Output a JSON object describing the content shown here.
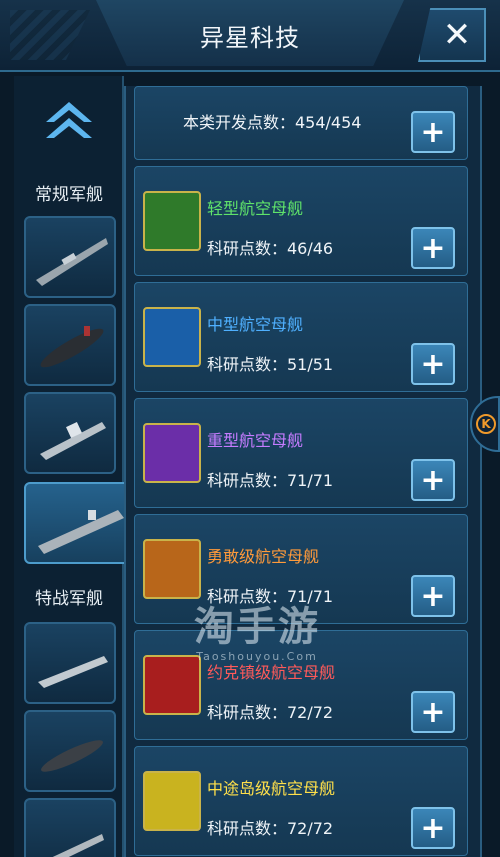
{
  "header": {
    "title": "异星科技"
  },
  "sidebar": {
    "categories": [
      {
        "label": "常规军舰"
      },
      {
        "label": "特战军舰"
      }
    ]
  },
  "list": {
    "summary": {
      "text": "本类开发点数：454/454"
    },
    "items": [
      {
        "name": "轻型航空母舰",
        "points": "科研点数：46/46",
        "name_color": "#5fe36a",
        "icon_color": "#2f7a2a"
      },
      {
        "name": "中型航空母舰",
        "points": "科研点数：51/51",
        "name_color": "#4fb0ff",
        "icon_color": "#1a5fa8"
      },
      {
        "name": "重型航空母舰",
        "points": "科研点数：71/71",
        "name_color": "#c57cff",
        "icon_color": "#6b2ea8"
      },
      {
        "name": "勇敢级航空母舰",
        "points": "科研点数：71/71",
        "name_color": "#ff9a3a",
        "icon_color": "#b8661a"
      },
      {
        "name": "约克镇级航空母舰",
        "points": "科研点数：72/72",
        "name_color": "#ff5a5a",
        "icon_color": "#a81e1e"
      },
      {
        "name": "中途岛级航空母舰",
        "points": "科研点数：72/72",
        "name_color": "#ffe04a",
        "icon_color": "#c9b31f"
      }
    ]
  },
  "watermark": {
    "main": "淘手游",
    "sub": "Taoshouyou.Com"
  }
}
